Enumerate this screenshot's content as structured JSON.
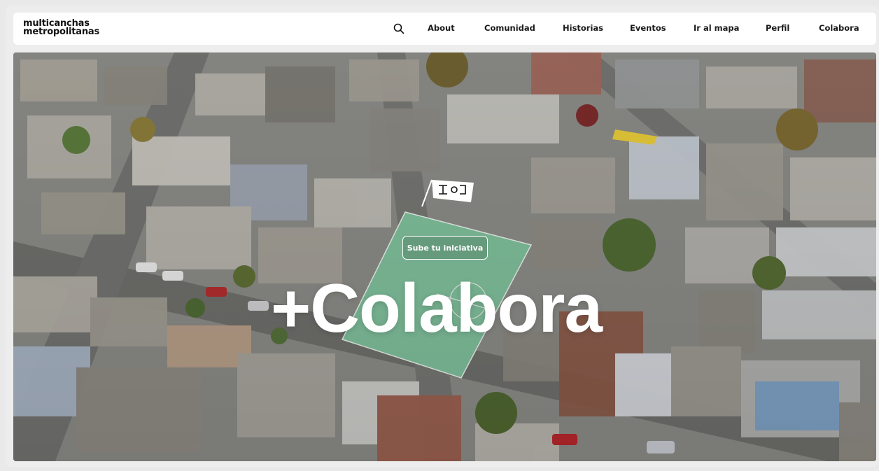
{
  "brand": {
    "line1": "multicanchas",
    "line2": "metropolitanas"
  },
  "nav": {
    "search_icon": "search-icon",
    "items": [
      {
        "label": "About"
      },
      {
        "label": "Comunidad"
      },
      {
        "label": "Historias"
      },
      {
        "label": "Eventos"
      },
      {
        "label": "Ir al mapa"
      },
      {
        "label": "Perfil"
      },
      {
        "label": "Colabora"
      }
    ]
  },
  "hero": {
    "cta_label": "Sube tu iniciativa",
    "headline": "+Colabora",
    "flag_icon": "flag-icon"
  },
  "colors": {
    "background": "#e9e9e9",
    "nav_bg": "#ffffff",
    "text": "#1a1a1a",
    "headline": "#ffffff",
    "court": "#7fbf9b"
  }
}
